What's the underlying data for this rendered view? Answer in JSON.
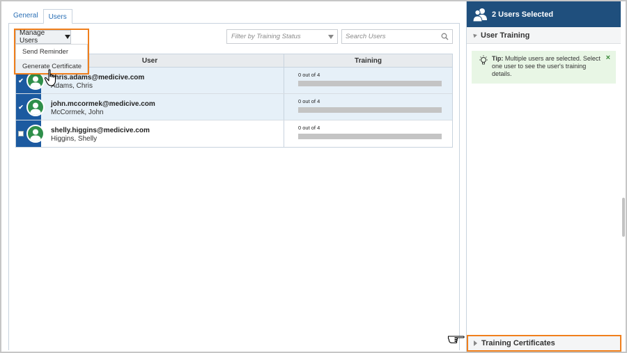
{
  "tabs": [
    {
      "label": "General",
      "active": false
    },
    {
      "label": "Users",
      "active": true
    }
  ],
  "toolbar": {
    "manage_label": "Manage Users",
    "filter_placeholder": "Filter by Training Status",
    "search_placeholder": "Search Users"
  },
  "menu": {
    "items": [
      {
        "label": "Send Reminder"
      },
      {
        "label": "Generate Certificate"
      }
    ]
  },
  "table": {
    "headers": {
      "user": "User",
      "training": "Training"
    },
    "rows": [
      {
        "email": "chris.adams@medicive.com",
        "name": "Adams, Chris",
        "training": "0 out of 4",
        "progress": 0,
        "checked": true
      },
      {
        "email": "john.mccormek@medicive.com",
        "name": "McCormek, John",
        "training": "0 out of 4",
        "progress": 0,
        "checked": true
      },
      {
        "email": "shelly.higgins@medicive.com",
        "name": "Higgins, Shelly",
        "training": "0 out of 4",
        "progress": 0,
        "checked": false
      }
    ]
  },
  "right_panel": {
    "header": "2 Users Selected",
    "section_title": "User Training",
    "tip_label": "Tip:",
    "tip_text": "Multiple users are selected. Select one user to see the user's training details.",
    "close_glyph": "×",
    "certificates_title": "Training Certificates"
  },
  "colors": {
    "accent_blue": "#1c5aa0",
    "header_blue": "#1f4f7d",
    "highlight_orange": "#f07f1c",
    "avatar_green": "#2f8f4a",
    "tip_green": "#e8f6e5"
  },
  "icons": {
    "header": "users-group-icon",
    "search": "search-icon",
    "tip": "lightbulb-icon",
    "avatar": "user-avatar-icon",
    "cursor": "hand-cursor-icon",
    "pointer": "pointing-hand-icon"
  }
}
